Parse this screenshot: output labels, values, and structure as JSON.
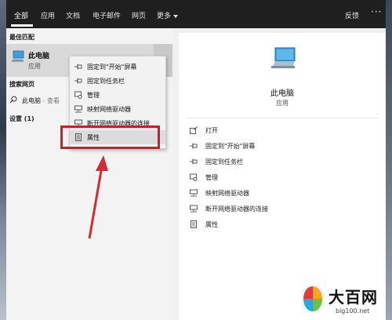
{
  "topbar": {
    "tabs": [
      "全部",
      "应用",
      "文档",
      "电子邮件",
      "网页",
      "更多"
    ],
    "feedback": "反馈"
  },
  "left": {
    "best_match_heading": "最佳匹配",
    "best_match": {
      "title": "此电脑",
      "subtitle": "应用"
    },
    "web_heading": "搜索网页",
    "web_item": {
      "text": "此电脑",
      "hint": " - 查看"
    },
    "settings_heading": "设置 (1)"
  },
  "context_menu": {
    "items": [
      {
        "label": "固定到\"开始\"屏幕",
        "icon": "pin-icon"
      },
      {
        "label": "固定到任务栏",
        "icon": "pin-icon"
      },
      {
        "label": "管理",
        "icon": "manage-icon"
      },
      {
        "label": "映射网络驱动器",
        "icon": "network-drive-icon"
      },
      {
        "label": "断开网络驱动器的连接",
        "icon": "network-drive-icon"
      },
      {
        "label": "属性",
        "icon": "properties-icon"
      }
    ],
    "highlighted_index": 5
  },
  "preview": {
    "title": "此电脑",
    "subtitle": "应用",
    "actions": [
      {
        "label": "打开",
        "icon": "open-icon"
      },
      {
        "label": "固定到\"开始\"屏幕",
        "icon": "pin-icon"
      },
      {
        "label": "固定到任务栏",
        "icon": "pin-icon"
      },
      {
        "label": "管理",
        "icon": "manage-icon"
      },
      {
        "label": "映射网络驱动器",
        "icon": "network-drive-icon"
      },
      {
        "label": "断开网络驱动器的连接",
        "icon": "network-drive-icon"
      },
      {
        "label": "属性",
        "icon": "properties-icon"
      }
    ]
  },
  "watermark": {
    "name": "大百网",
    "url": "big100.net"
  },
  "colors": {
    "highlight": "#c8202a",
    "topbar": "#1f1f1f",
    "accent": "#1e90d6"
  }
}
